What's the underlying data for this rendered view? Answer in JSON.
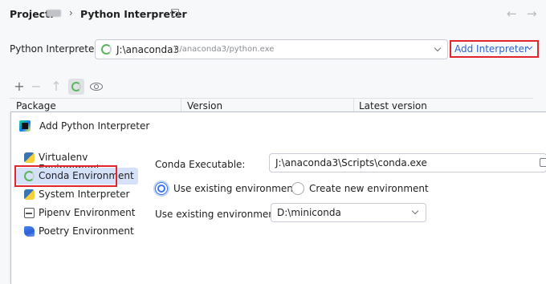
{
  "header": {
    "project_label": "Project:",
    "separator": "›",
    "current": "Python Interpreter",
    "back_arrow": "←",
    "forward_arrow": "→"
  },
  "interpreter": {
    "label": "Python Interpreter:",
    "name": "J:\\anaconda3",
    "path": "J:/anaconda3/python.exe",
    "add_button_label": "Add Interpreter"
  },
  "toolbar": {
    "add": "+",
    "remove": "−",
    "upgrade": "↑",
    "icons": [
      "plus-icon",
      "minus-icon",
      "upgrade-icon",
      "conda-icon",
      "eye-icon"
    ]
  },
  "packages_table": {
    "columns": [
      "Package",
      "Version",
      "Latest version"
    ]
  },
  "dialog": {
    "title": "Add Python Interpreter",
    "sidebar": {
      "items": [
        {
          "label": "Virtualenv Environment",
          "icon": "python-icon"
        },
        {
          "label": "Conda Environment",
          "icon": "conda-icon",
          "selected": true
        },
        {
          "label": "System Interpreter",
          "icon": "python-icon"
        },
        {
          "label": "Pipenv Environment",
          "icon": "pipenv-icon"
        },
        {
          "label": "Poetry Environment",
          "icon": "poetry-icon"
        }
      ]
    },
    "form": {
      "conda_exec_label": "Conda Executable:",
      "conda_exec_value": "J:\\anaconda3\\Scripts\\conda.exe",
      "radio_existing": "Use existing environment",
      "radio_new": "Create new environment",
      "radio_selected": "existing",
      "existing_env_label": "Use existing environment:",
      "existing_env_value": "D:\\miniconda"
    }
  },
  "colors": {
    "accent": "#3574f0",
    "link": "#2f64d1",
    "highlight_box": "#e2252b",
    "conda_green": "#5bb65a",
    "selection": "#d5e1f9"
  }
}
